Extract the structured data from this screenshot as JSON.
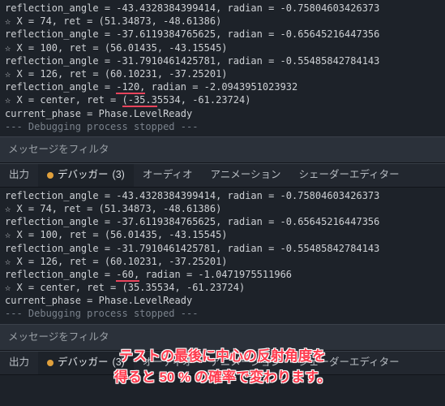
{
  "console_top": {
    "lines": [
      {
        "text": "reflection_angle = -43.4328384399414, radian = -0.75804603426373"
      },
      {
        "text": "☆ X = 74, ret = (51.34873, -48.61386)"
      },
      {
        "text": "reflection_angle = -37.6119384765625, radian = -0.65645216447356"
      },
      {
        "text": "☆ X = 100, ret = (56.01435, -43.15545)"
      },
      {
        "text": "reflection_angle = -31.7910461425781, radian = -0.55485842784143"
      },
      {
        "text": "☆ X = 126, ret = (60.10231, -37.25201)"
      },
      {
        "text": "reflection_angle = ",
        "mark": "-120,",
        "after": " radian = -2.0943951023932"
      },
      {
        "text": "☆ X = center, ret = (-35.35534, -61.23724)",
        "mark_start": 20,
        "mark_end": 26
      },
      {
        "text": "current_phase = Phase.LevelReady"
      },
      {
        "text": "--- Debugging process stopped ---",
        "cls": "stopped"
      }
    ]
  },
  "filter_placeholder": "メッセージをフィルタ",
  "tabs": {
    "output": "出力",
    "debugger": "デバッガー",
    "debugger_count": "(3)",
    "audio": "オーディオ",
    "animation": "アニメーション",
    "shader": "シェーダーエディター"
  },
  "console_bottom": {
    "lines": [
      {
        "text": "reflection_angle = -43.4328384399414, radian = -0.75804603426373"
      },
      {
        "text": "☆ X = 74, ret = (51.34873, -48.61386)"
      },
      {
        "text": "reflection_angle = -37.6119384765625, radian = -0.65645216447356"
      },
      {
        "text": "☆ X = 100, ret = (56.01435, -43.15545)"
      },
      {
        "text": "reflection_angle = -31.7910461425781, radian = -0.55485842784143"
      },
      {
        "text": "☆ X = 126, ret = (60.10231, -37.25201)"
      },
      {
        "text": "reflection_angle = ",
        "mark": "-60,",
        "after": " radian = -1.0471975511966"
      },
      {
        "text": "☆ X = center, ret = (35.35534, -61.23724)"
      },
      {
        "text": "current_phase = Phase.LevelReady"
      },
      {
        "text": "--- Debugging process stopped ---",
        "cls": "stopped"
      }
    ]
  },
  "overlay": {
    "line1": "テストの最後に中心の反射角度を",
    "line2": "得ると 50 % の確率で変わります。"
  },
  "colors": {
    "bg": "#1d2229",
    "panel": "#2b313a",
    "accent_red": "#e8445c",
    "accent_amber": "#e0a03c",
    "overlay_red": "#ff3b4e"
  }
}
